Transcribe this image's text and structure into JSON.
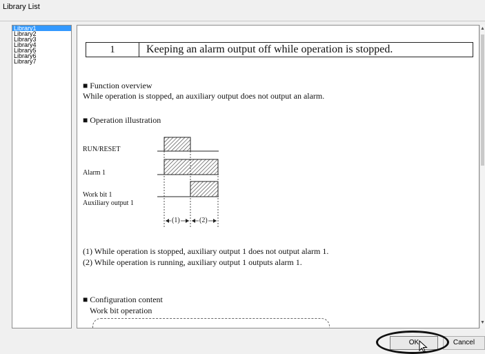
{
  "window": {
    "title": "Library List"
  },
  "library_list": {
    "items": [
      {
        "label": "Library1",
        "selected": true
      },
      {
        "label": "Library2"
      },
      {
        "label": "Library3"
      },
      {
        "label": "Library4"
      },
      {
        "label": "Library5"
      },
      {
        "label": "Library6"
      },
      {
        "label": "Library7"
      }
    ]
  },
  "content": {
    "heading": {
      "number": "1",
      "text": "Keeping an alarm output off while operation is stopped."
    },
    "function_overview": {
      "title": "■ Function overview",
      "text": "While operation is stopped, an auxiliary output does not output an alarm."
    },
    "operation_illustration": {
      "title": "■ Operation illustration",
      "labels": {
        "run_reset": "RUN/RESET",
        "alarm1": "Alarm 1",
        "work_bit1": "Work bit 1",
        "aux_output1": "Auxiliary output 1",
        "interval1": "(1)",
        "interval2": "(2)"
      }
    },
    "notes": [
      "(1) While operation is stopped, auxiliary output 1 does not output alarm 1.",
      "(2) While operation is running, auxiliary output 1 outputs alarm 1."
    ],
    "configuration": {
      "title": "■ Configuration content",
      "subtitle": "Work bit operation"
    }
  },
  "buttons": {
    "ok": "OK",
    "cancel": "Cancel"
  },
  "icons": {
    "cursor": "pointer-arrow-icon",
    "scroll_up": "scroll-up-arrow-icon",
    "scroll_down": "scroll-down-arrow-icon"
  },
  "colors": {
    "selection": "#3399ff",
    "highlight_circle": "#111111"
  }
}
